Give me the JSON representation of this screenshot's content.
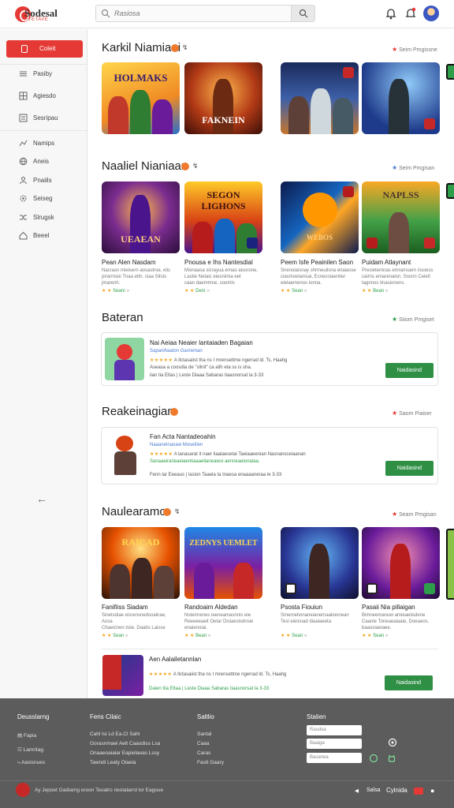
{
  "header": {
    "logo_title": "Sodesal",
    "logo_subtitle": "PYETAVE",
    "search_placeholder": "Rasiosa"
  },
  "sidebar": {
    "active_label": "Coleit",
    "items": [
      {
        "label": "Pasiby",
        "icon": "menu-icon"
      },
      {
        "label": "Agiesdo",
        "icon": "grid-icon"
      },
      {
        "label": "Sesripau",
        "icon": "list-icon"
      },
      {
        "label": "Namips",
        "icon": "chart-icon"
      },
      {
        "label": "Aneis",
        "icon": "globe-icon"
      },
      {
        "label": "Pnaiils",
        "icon": "user-icon"
      },
      {
        "label": "Seiseg",
        "icon": "settings-icon"
      },
      {
        "label": "Slrugsk",
        "icon": "shuffle-icon"
      },
      {
        "label": "Beeel",
        "icon": "home-icon"
      }
    ]
  },
  "sections": {
    "s1": {
      "title": "Karkil Niamiaai",
      "link": "Seim Pmgissne"
    },
    "s2": {
      "title": "Naaliel Nianiaan",
      "link": "Seim Pmgisan"
    },
    "s3": {
      "title": "Bateran",
      "link": "Siiom Pmgiset"
    },
    "s4": {
      "title": "Reakeinagiam",
      "link": "Saom Piaiser"
    },
    "s5": {
      "title": "Naulearamo",
      "link": "Seam Pmgisan"
    }
  },
  "row1_tiles": [
    {
      "overlay": "HOLMAKS"
    },
    {
      "overlay": "FAKNEIN"
    },
    {
      "overlay": ""
    },
    {
      "overlay": ""
    }
  ],
  "row2_games": [
    {
      "overlay": "UEAEAN",
      "name": "Pean Alen Nasdam",
      "desc": [
        "Nacrasn mieisern aosastroe, elis",
        "pirarmsie Tnaa ettn. ciaa Sitsts",
        "jmarenh."
      ],
      "rating": "Seam"
    },
    {
      "overlay": "SEGON LIGHONS",
      "name": "Pnousa e Ihs Nantesdial",
      "desc": [
        "Msinaasa sicrayua ernao aisorone,",
        "Lastie Netaic eiesnimia eet",
        "caan daemmne, soomls"
      ],
      "rating": "Deni"
    },
    {
      "overlay": "WEBOS",
      "name": "Peem Isfe Peainilen Saon",
      "desc": [
        "Snenoiaisnay shrmeuilsna enaiasse",
        "ciasmoelanisai, Ecnecoiaentier",
        "elelaemenos ionna."
      ],
      "rating": "Sean"
    },
    {
      "overlay": "NAPLSS",
      "name": "Puidam Atlaynant",
      "desc": [
        "Precietemnas emrarnuern iisciess",
        "cairns emarenatsn. Sosnn Celetl",
        "tagnnos Iinasionens."
      ],
      "rating": "Bean"
    }
  ],
  "card3": {
    "title": "Nai Aeiaa Neaier lantaiaden Bagaian",
    "line1": "Sapanihaaton Gavreman",
    "line2": "A Ilctasaiist tha ns I mrensettme ngerrad ld. Ts, Haahg",
    "line3": "Aseasa a coosdia de \"sllnit\" ca ailh eta ss is sha.",
    "line4": "ilan tia Eltas | Leste Diaaa Sabaras tiaasnorsat la 3-33",
    "button": "Naidasind"
  },
  "card4": {
    "title": "Fan Acta Nantadeoahin",
    "line1": "Naaaneinaoaw Mosetilen",
    "line2": "A lanasarat it naer liaalaesetai Taeiaaeenian Nasnansceiaanan",
    "line3": "Sanaaeirarieaeiaentiaaaelianeaiesi aenneaeionalaa.",
    "line4": "Fenn lar Eeeaus | lasion Taaela ta Inaesa enaaaaneraa le 3-33",
    "button": "Naidasind"
  },
  "row5_games": [
    {
      "overlay": "RAICAD",
      "name": "Fanifiiss Siadam",
      "desc": [
        "Sinetsdiae eisrensnedsoaiirae, Aosa",
        "Chaeicnen tsiie. Daabs Laisse"
      ],
      "rating": "Sean"
    },
    {
      "overlay": "ZEDNYS UEMLET",
      "name": "Randoaim Aldedan",
      "desc": [
        "Nstemrenes ieeneamasnnis eie",
        "Reeeeeaeit Oetar Disiaesisdnsie",
        "enaienoiai."
      ],
      "rating": "Bean"
    },
    {
      "overlay": "",
      "name": "Psosta Fiouiun",
      "desc": [
        "Smernetionaneianernaalioonean",
        "Tesl eieisnad diaaiaeeta"
      ],
      "rating": "Sean"
    },
    {
      "overlay": "",
      "name": "Pasaii Nia pillaigan",
      "desc": [
        "Bimneemanoei amieaeiisdene",
        "Caanie Toneaeaiaaie, Doeaeos.",
        "baaosiaeiaee."
      ],
      "rating": "Sean"
    }
  ],
  "card5": {
    "title": "Aen Aalailetannlan",
    "line2": "A Ilctasaiist tha ns I mrensettme ngerrad ld. Ts, Haahg",
    "line4": "Daien tiia Eltaa | Leste Diaaa Sabaras tiaasnorsat la 3-33",
    "button": "Naidasind"
  },
  "footer": {
    "col1_title": "Deusslarng",
    "col1_items": [
      "Fapia",
      "Lamritag",
      "Aasisnues"
    ],
    "col2_title": "Fens Cilaic",
    "col2_items": [
      "Cahl Isi Ld Ea.Cl Sahl",
      "Gorasnmael Aelt Caaodiss Lsa",
      "Onaaeoaiaiar Eapielaeas Lssy",
      "Tawndi Leaty Oiaeia"
    ],
    "col3_title": "Saltlio",
    "col3_items": [
      "Santal",
      "Caaa",
      "Caras",
      "Fastt Gaary"
    ],
    "col4_title": "Stalien",
    "col4_inputs": [
      "Rasdoa",
      "Baaiga",
      "Basanea"
    ],
    "copyright": "Ay Jepoet Gadiamg eroon Teoatro rieoiatarrd lor Eagoue",
    "right_label1": "Salsa",
    "right_label2": "Cylnida"
  }
}
